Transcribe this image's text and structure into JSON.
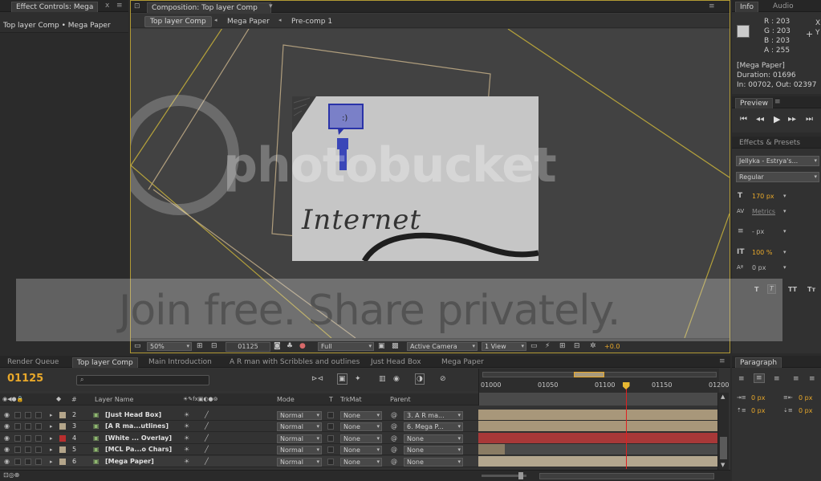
{
  "effect_controls": {
    "tab_label": "Effect Controls: Mega",
    "subtitle": "Top layer Comp • Mega Paper"
  },
  "composition": {
    "tab_label": "Composition: Top layer Comp",
    "breadcrumbs": [
      "Top layer Comp",
      "Mega Paper",
      "Pre-comp 1"
    ],
    "canvas_text": "Internet",
    "watermark": "photobucket",
    "overlay_text": "Join free. Share privately.",
    "footer": {
      "zoom": "50%",
      "timecode": "01125",
      "resolution": "Full",
      "camera": "Active Camera",
      "view": "1 View",
      "exposure": "+0.0"
    }
  },
  "info": {
    "tabs": [
      "Info",
      "Audio"
    ],
    "color": "#cbcbcb",
    "r": "R : 203",
    "g": "G : 203",
    "b": "B : 203",
    "a": "A : 255",
    "xy": [
      "X",
      "Y"
    ],
    "layer_name": "[Mega Paper]",
    "duration": "Duration: 01696",
    "in_out": "In: 00702, Out: 02397"
  },
  "preview": {
    "tab_label": "Preview",
    "controls": [
      "first-frame",
      "prev-frame",
      "play",
      "next-frame",
      "last-frame"
    ]
  },
  "effects_presets": {
    "tab_label": "Effects & Presets",
    "font": "Jellyka - Estrya's...",
    "style": "Regular",
    "size": "170 px",
    "kerning": "Metrics",
    "leading": "- px",
    "vscale": "100 %",
    "baseline": "0 px"
  },
  "paragraph": {
    "tab_label": "Paragraph",
    "indent_values": [
      "0 px",
      "0 px",
      "0 px",
      "0 px"
    ]
  },
  "timeline": {
    "tabs": [
      "Render Queue",
      "Top layer Comp",
      "Main Introduction",
      "A R man with Scribbles and outlines",
      "Just Head Box",
      "Mega Paper"
    ],
    "active_tab": 1,
    "timecode": "01125",
    "search_placeholder": "",
    "columns": {
      "num": "#",
      "layer_name": "Layer Name",
      "mode": "Mode",
      "t": "T",
      "trkmat": "TrkMat",
      "parent": "Parent"
    },
    "ruler": [
      "01000",
      "01050",
      "01100",
      "01150",
      "01200"
    ],
    "playhead_frame": 1125,
    "ruler_start": 1000,
    "ruler_end": 1200,
    "layers": [
      {
        "num": "2",
        "name": "[Just Head Box]",
        "color": "#b4a58a",
        "mode": "Normal",
        "trkmat": "None",
        "parent": "3. A R ma...",
        "bar_color": "#a8977a",
        "bar_start": 0,
        "bar_end": 1
      },
      {
        "num": "3",
        "name": "[A R ma...utlines]",
        "color": "#b4a58a",
        "mode": "Normal",
        "trkmat": "None",
        "parent": "6. Mega P...",
        "bar_color": "#a8977a",
        "bar_start": 0,
        "bar_end": 1
      },
      {
        "num": "4",
        "name": "[White ... Overlay]",
        "color": "#b82e2e",
        "mode": "Normal",
        "trkmat": "None",
        "parent": "None",
        "bar_color": "#a83838",
        "bar_start": 0,
        "bar_end": 1
      },
      {
        "num": "5",
        "name": "[MCL Pa...o Chars]",
        "color": "#b4a58a",
        "mode": "Normal",
        "trkmat": "None",
        "parent": "None",
        "bar_color": "#8a7c64",
        "bar_start": 0,
        "bar_end": 0.11
      },
      {
        "num": "6",
        "name": "[Mega Paper]",
        "color": "#b4a58a",
        "mode": "Normal",
        "trkmat": "None",
        "parent": "None",
        "bar_color": "#b3a68e",
        "bar_start": 0,
        "bar_end": 1
      }
    ]
  },
  "colors": {
    "accent_timecode": "#e8a82a",
    "playhead": "#e02020",
    "guide_yellow": "#c8b23a"
  }
}
